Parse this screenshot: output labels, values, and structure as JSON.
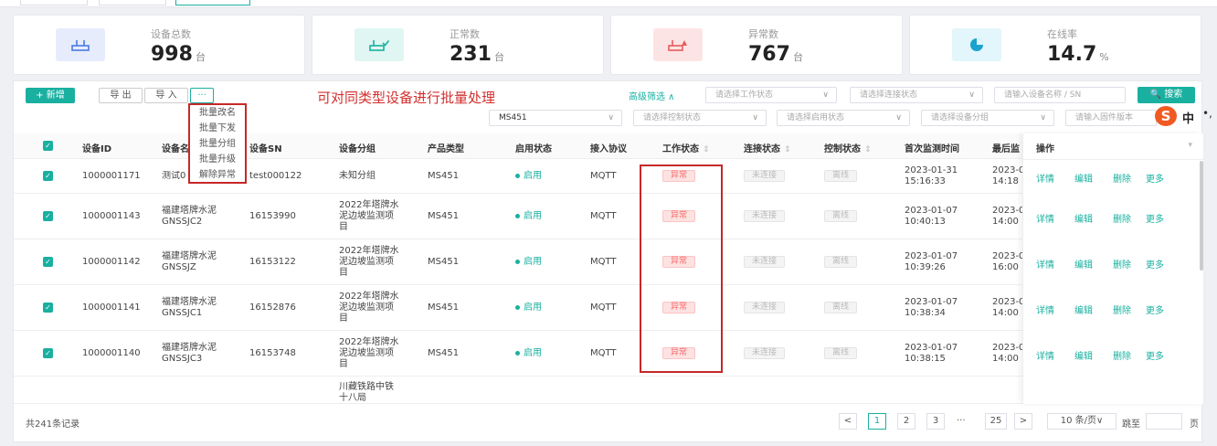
{
  "stats": [
    {
      "label": "设备总数",
      "value": "998",
      "unit": "台",
      "icon": "router-icon",
      "bg": "#e6ecfb",
      "color": "#4a7be0"
    },
    {
      "label": "正常数",
      "value": "231",
      "unit": "台",
      "icon": "router-check-icon",
      "bg": "#e0f6f2",
      "color": "#19b0a0"
    },
    {
      "label": "异常数",
      "value": "767",
      "unit": "台",
      "icon": "router-alert-icon",
      "bg": "#fde4e4",
      "color": "#e85a5a"
    },
    {
      "label": "在线率",
      "value": "14.7",
      "unit": "%",
      "icon": "pie-chart-icon",
      "bg": "#e2f6fb",
      "color": "#1aa3cf"
    }
  ],
  "toolbar": {
    "add": "+ 新增",
    "export": "导 出",
    "import": "导 入",
    "more": "···"
  },
  "more_menu": [
    "批量改名",
    "批量下发",
    "批量分组",
    "批量升级",
    "解除异常"
  ],
  "annotation": "可对同类型设备进行批量处理",
  "filters": {
    "advanced": "高级筛选 ∧",
    "work_status": "请选择工作状态",
    "connect_status": "请选择连接状态",
    "name_sn": "请输入设备名称 / SN",
    "search": "🔍 搜索",
    "product": "MS451",
    "control_status": "请选择控制状态",
    "enable_status": "请选择启用状态",
    "group": "请选择设备分组",
    "firmware": "请输入固件版本"
  },
  "columns": [
    "设备ID",
    "设备名",
    "设备SN",
    "设备分组",
    "产品类型",
    "启用状态",
    "接入协议",
    "工作状态",
    "连接状态",
    "控制状态",
    "首次监测时间",
    "最后监",
    "操作"
  ],
  "rows": [
    {
      "id": "1000001171",
      "name1": "测试0",
      "name2": "",
      "sn": "test000122",
      "g1": "未知分组",
      "g2": "",
      "g3": "",
      "product": "MS451",
      "enable": "启用",
      "protocol": "MQTT",
      "work": "异常",
      "conn": "未连接",
      "ctrl": "离线",
      "first1": "2023-01-31",
      "first2": "15:16:33",
      "last1": "2023-0",
      "last2": "14:18"
    },
    {
      "id": "1000001143",
      "name1": "福建塔牌水泥",
      "name2": "GNSSJC2",
      "sn": "16153990",
      "g1": "2022年塔牌水",
      "g2": "泥边坡监测项",
      "g3": "目",
      "product": "MS451",
      "enable": "启用",
      "protocol": "MQTT",
      "work": "异常",
      "conn": "未连接",
      "ctrl": "离线",
      "first1": "2023-01-07",
      "first2": "10:40:13",
      "last1": "2023-0",
      "last2": "14:00"
    },
    {
      "id": "1000001142",
      "name1": "福建塔牌水泥",
      "name2": "GNSSJZ",
      "sn": "16153122",
      "g1": "2022年塔牌水",
      "g2": "泥边坡监测项",
      "g3": "目",
      "product": "MS451",
      "enable": "启用",
      "protocol": "MQTT",
      "work": "异常",
      "conn": "未连接",
      "ctrl": "离线",
      "first1": "2023-01-07",
      "first2": "10:39:26",
      "last1": "2023-0",
      "last2": "16:00"
    },
    {
      "id": "1000001141",
      "name1": "福建塔牌水泥",
      "name2": "GNSSJC1",
      "sn": "16152876",
      "g1": "2022年塔牌水",
      "g2": "泥边坡监测项",
      "g3": "目",
      "product": "MS451",
      "enable": "启用",
      "protocol": "MQTT",
      "work": "异常",
      "conn": "未连接",
      "ctrl": "离线",
      "first1": "2023-01-07",
      "first2": "10:38:34",
      "last1": "2023-0",
      "last2": "14:00"
    },
    {
      "id": "1000001140",
      "name1": "福建塔牌水泥",
      "name2": "GNSSJC3",
      "sn": "16153748",
      "g1": "2022年塔牌水",
      "g2": "泥边坡监测项",
      "g3": "目",
      "product": "MS451",
      "enable": "启用",
      "protocol": "MQTT",
      "work": "异常",
      "conn": "未连接",
      "ctrl": "离线",
      "first1": "2023-01-07",
      "first2": "10:38:15",
      "last1": "2023-0",
      "last2": "14:00"
    }
  ],
  "partial_row": {
    "g1": "川藏铁路中铁",
    "g2": "十八局"
  },
  "actions": [
    "详情",
    "编辑",
    "删除",
    "更多"
  ],
  "footer": {
    "total": "共241条记录",
    "prev": "<",
    "next": ">",
    "pages": [
      "1",
      "2",
      "3",
      "···",
      "25"
    ],
    "page_size": "10 条/页∨",
    "jump": "跳至",
    "page_unit": "页"
  },
  "ime": {
    "logo": "S",
    "mode": "中",
    "dots": "•,"
  }
}
